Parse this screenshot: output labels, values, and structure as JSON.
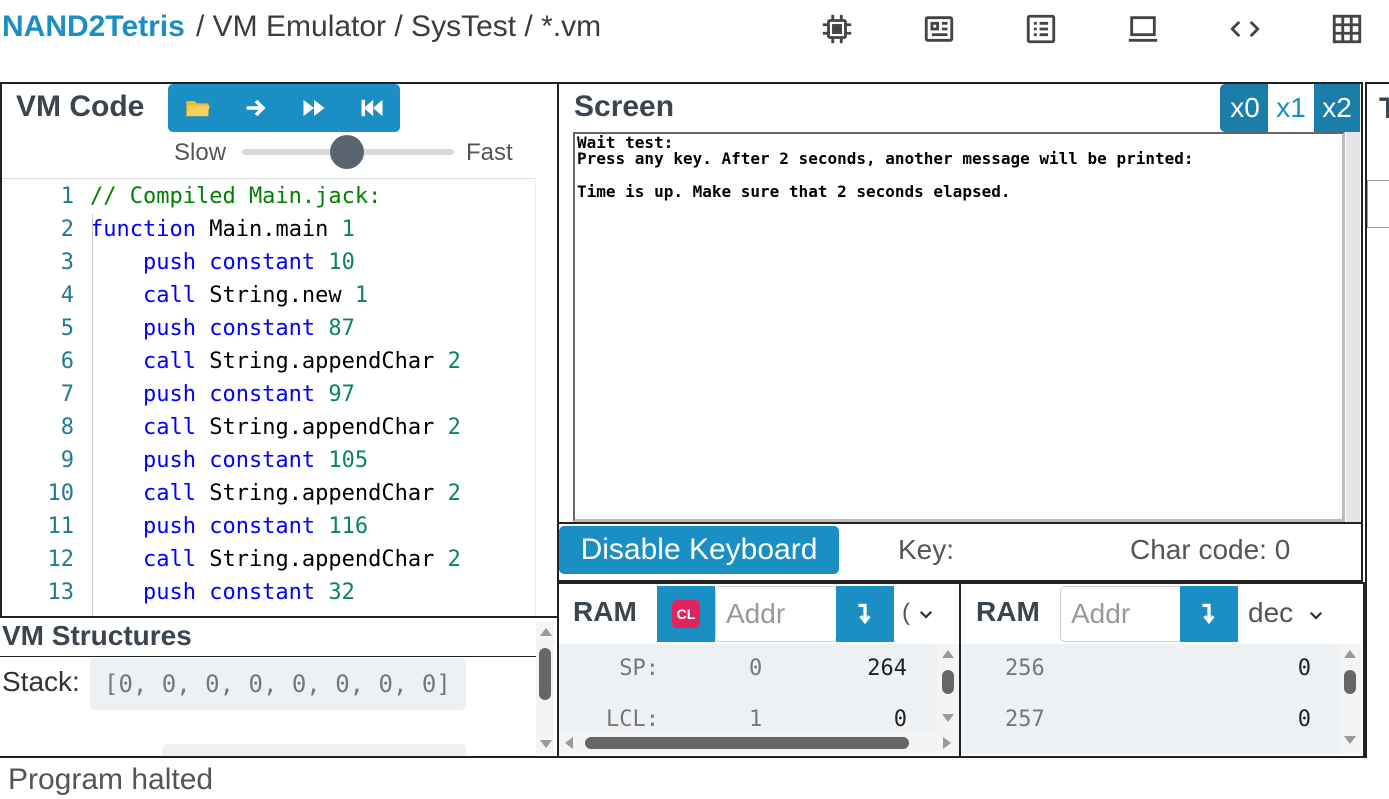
{
  "header": {
    "brand": "NAND2Tetris",
    "breadcrumb": "/ VM Emulator / SysTest / *.vm",
    "icons": [
      "chip-icon",
      "cpu-board-icon",
      "list-icon",
      "laptop-icon",
      "code-icon",
      "grid-icon"
    ]
  },
  "vm_code": {
    "title": "VM Code",
    "speed_slow": "Slow",
    "speed_fast": "Fast",
    "speed_level_fraction": 0.5,
    "lines": [
      {
        "n": "1",
        "parts": [
          [
            "cmt",
            "// Compiled Main.jack:"
          ]
        ]
      },
      {
        "n": "2",
        "parts": [
          [
            "kw",
            "function "
          ],
          [
            "id",
            "Main.main "
          ],
          [
            "num",
            "1"
          ]
        ]
      },
      {
        "n": "3",
        "parts": [
          [
            "kw",
            "    push constant "
          ],
          [
            "num",
            "10"
          ]
        ]
      },
      {
        "n": "4",
        "parts": [
          [
            "kw",
            "    call "
          ],
          [
            "id",
            "String.new "
          ],
          [
            "num",
            "1"
          ]
        ]
      },
      {
        "n": "5",
        "parts": [
          [
            "kw",
            "    push constant "
          ],
          [
            "num",
            "87"
          ]
        ]
      },
      {
        "n": "6",
        "parts": [
          [
            "kw",
            "    call "
          ],
          [
            "id",
            "String.appendChar "
          ],
          [
            "num",
            "2"
          ]
        ]
      },
      {
        "n": "7",
        "parts": [
          [
            "kw",
            "    push constant "
          ],
          [
            "num",
            "97"
          ]
        ]
      },
      {
        "n": "8",
        "parts": [
          [
            "kw",
            "    call "
          ],
          [
            "id",
            "String.appendChar "
          ],
          [
            "num",
            "2"
          ]
        ]
      },
      {
        "n": "9",
        "parts": [
          [
            "kw",
            "    push constant "
          ],
          [
            "num",
            "105"
          ]
        ]
      },
      {
        "n": "10",
        "parts": [
          [
            "kw",
            "    call "
          ],
          [
            "id",
            "String.appendChar "
          ],
          [
            "num",
            "2"
          ]
        ]
      },
      {
        "n": "11",
        "parts": [
          [
            "kw",
            "    push constant "
          ],
          [
            "num",
            "116"
          ]
        ]
      },
      {
        "n": "12",
        "parts": [
          [
            "kw",
            "    call "
          ],
          [
            "id",
            "String.appendChar "
          ],
          [
            "num",
            "2"
          ]
        ]
      },
      {
        "n": "13",
        "parts": [
          [
            "kw",
            "    push constant "
          ],
          [
            "num",
            "32"
          ]
        ]
      }
    ]
  },
  "vm_structures": {
    "title": "VM Structures",
    "stack_label": "Stack:",
    "stack_value": "[0, 0, 0, 0, 0, 0, 0, 0]"
  },
  "screen": {
    "title": "Screen",
    "zoom": [
      "x0",
      "x1",
      "x2"
    ],
    "zoom_selected": "x1",
    "lines": [
      "Wait test:",
      "Press any key. After 2 seconds, another message will be printed:",
      "Time is up. Make sure that 2 seconds elapsed."
    ],
    "keyboard_button": "Disable Keyboard",
    "key_label": "Key:",
    "char_code_label": "Char code: 0"
  },
  "ram_left": {
    "title": "RAM",
    "clear_label": "CL",
    "addr_placeholder": "Addr",
    "format_partial": "(",
    "rows": [
      {
        "label": "SP:",
        "addr": "0",
        "value": "264"
      },
      {
        "label": "LCL:",
        "addr": "1",
        "value": "0"
      }
    ]
  },
  "ram_right": {
    "title": "RAM",
    "addr_placeholder": "Addr",
    "format": "dec",
    "rows": [
      {
        "addr": "256",
        "value": "0"
      },
      {
        "addr": "257",
        "value": "0"
      }
    ]
  },
  "status": "Program halted",
  "colors": {
    "accent": "#1b8fc4",
    "clear_button": "#e0245e"
  }
}
